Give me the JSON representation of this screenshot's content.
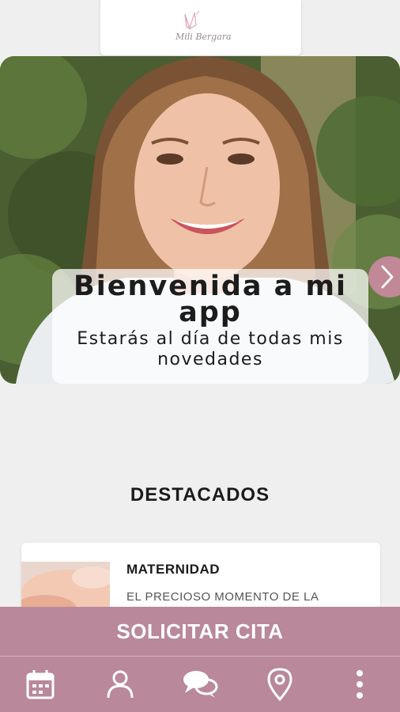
{
  "header": {
    "logo_icon": "butterfly-logo-icon",
    "logo_text": "Mili Bergara"
  },
  "hero": {
    "title": "Bienvenida a mi app",
    "subtitle": "Estarás al día de todas mis novedades",
    "next_icon": "chevron-right-icon"
  },
  "featured": {
    "section_title": "DESTACADOS",
    "items": [
      {
        "title": "MATERNIDAD",
        "text": "EL PRECIOSO MOMENTO DE LA"
      }
    ]
  },
  "cta": {
    "label": "SOLICITAR CITA"
  },
  "bottom_nav": {
    "items": [
      {
        "icon": "calendar-icon"
      },
      {
        "icon": "user-icon"
      },
      {
        "icon": "chat-bubbles-icon"
      },
      {
        "icon": "location-pin-icon"
      },
      {
        "icon": "more-vertical-icon"
      }
    ]
  },
  "colors": {
    "brand": "#b9889a",
    "background": "#efefef",
    "text": "#1b1b1b"
  }
}
